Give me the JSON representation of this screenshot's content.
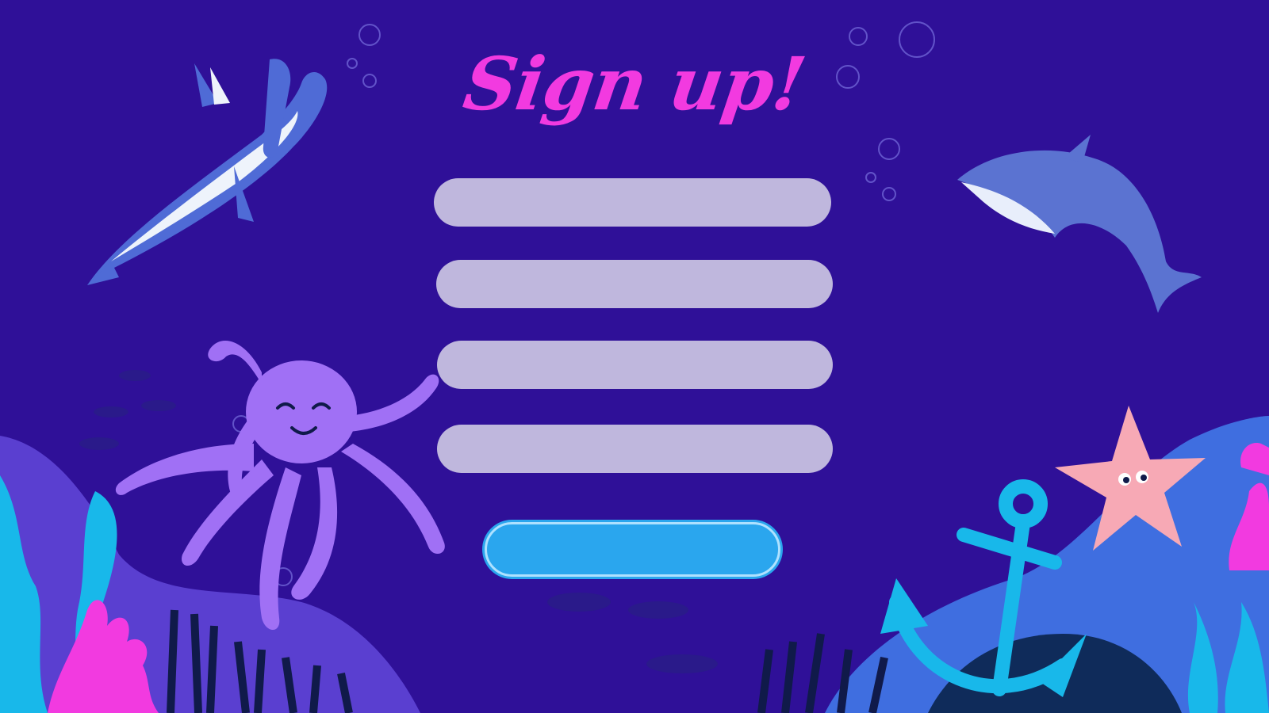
{
  "page": {
    "title": "Sign up!"
  },
  "form": {
    "fields": [
      {
        "value": "",
        "placeholder": ""
      },
      {
        "value": "",
        "placeholder": ""
      },
      {
        "value": "",
        "placeholder": ""
      },
      {
        "value": "",
        "placeholder": ""
      }
    ],
    "submit_label": ""
  },
  "theme": {
    "background": "#2f1098",
    "title_color": "#f23ae0",
    "field_color": "#bfb7dd",
    "button_color": "#2aa6ee",
    "octopus_color": "#a070f5",
    "starfish_color": "#f7a9b5",
    "anchor_color": "#18b8ea",
    "coral_color": "#f23ae0"
  },
  "illustrations": [
    "hammerhead-shark",
    "dolphin",
    "octopus",
    "starfish",
    "anchor",
    "coral",
    "seaweed",
    "fish-school",
    "bubbles"
  ]
}
